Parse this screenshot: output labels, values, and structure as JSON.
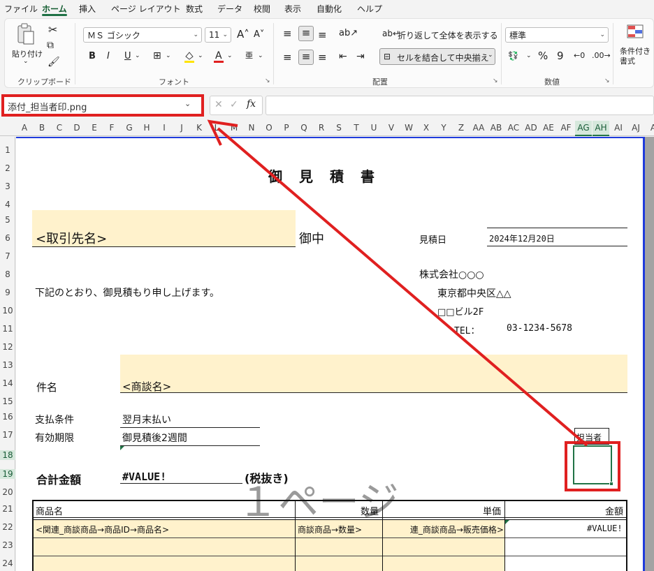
{
  "menu": [
    "ファイル",
    "ホーム",
    "挿入",
    "ページ レイアウト",
    "数式",
    "データ",
    "校閲",
    "表示",
    "自動化",
    "ヘルプ"
  ],
  "ribbon": {
    "clipboard": {
      "paste_label": "貼り付け",
      "group_label": "クリップボード"
    },
    "font": {
      "font_name": "ＭＳ ゴシック",
      "font_size": "11",
      "group_label": "フォント",
      "bold": "B",
      "italic": "I",
      "underline": "U",
      "grow": "A^",
      "shrink": "Aˇ"
    },
    "alignment": {
      "wrap_label": "折り返して全体を表示する",
      "merge_label": "セルを結合して中央揃え",
      "group_label": "配置"
    },
    "number": {
      "format": "標準",
      "percent": "%",
      "comma": "9",
      "group_label": "数値"
    },
    "styles": {
      "conditional_label": "条件付き\n書式"
    }
  },
  "formula_bar": {
    "name_box": "添付_担当者印.png",
    "formula": "",
    "fx": "fx"
  },
  "columns": [
    "A",
    "B",
    "C",
    "D",
    "E",
    "F",
    "G",
    "H",
    "I",
    "J",
    "K",
    "L",
    "M",
    "N",
    "O",
    "P",
    "Q",
    "R",
    "S",
    "T",
    "U",
    "V",
    "W",
    "X",
    "Y",
    "Z",
    "AA",
    "AB",
    "AC",
    "AD",
    "AE",
    "AF",
    "AG",
    "AH",
    "AI",
    "AJ",
    "A"
  ],
  "rows": [
    "1",
    "2",
    "3",
    "4",
    "5",
    "6",
    "7",
    "8",
    "9",
    "10",
    "11",
    "12",
    "13",
    "14",
    "15",
    "16",
    "17",
    "18",
    "19",
    "20",
    "21",
    "22",
    "23",
    "24"
  ],
  "sheet": {
    "title": "御　見　積　書",
    "client": "<取引先名>",
    "onchu": "御中",
    "date_label": "見積日",
    "date_value": "2024年12月20日",
    "company": "株式会社○○○",
    "address1": "東京都中央区△△",
    "address2": "□□ビル2F",
    "tel_label": "TEL：",
    "tel_value": "03-1234-5678",
    "intro": "下記のとおり、御見積もり申し上げます。",
    "subject_label": "件名",
    "subject_value": "<商談名>",
    "payment_label": "支払条件",
    "payment_value": "翌月末払い",
    "validity_label": "有効期限",
    "validity_value": "御見積後2週間",
    "stamp_label": "担当者",
    "total_label": "合計金額",
    "total_value": "#VALUE!",
    "tax_note": "(税抜き)",
    "page_watermark": "１ページ",
    "table_headers": [
      "商品名",
      "数量",
      "単価",
      "金額"
    ],
    "table_row1": [
      "<関連_商談商品→商品ID→商品名>",
      "商談商品→数量>",
      "連_商談商品→販売価格>",
      "#VALUE!"
    ]
  },
  "colors": {
    "accent": "#217346",
    "highlight": "#e02020",
    "fill": "#fff2cc",
    "page_border": "#1f3bdc"
  }
}
